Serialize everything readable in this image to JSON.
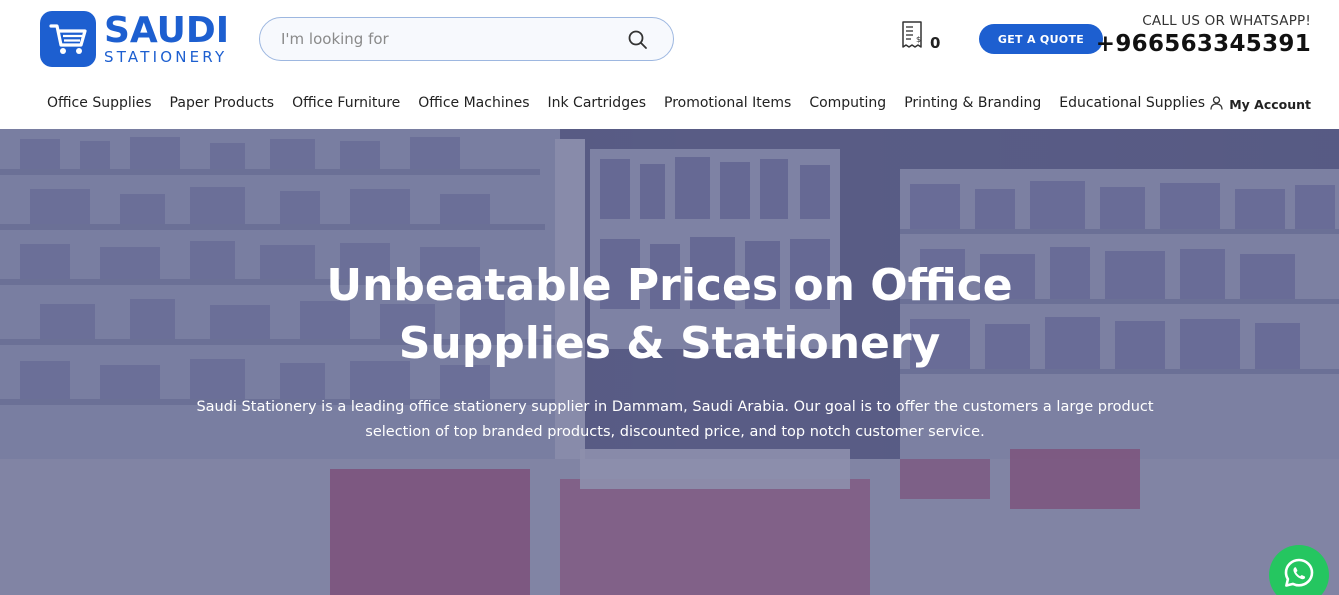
{
  "header": {
    "logo": {
      "main": "SAUDI",
      "sub": "STATIONERY"
    },
    "search": {
      "placeholder": "I'm looking for"
    },
    "quote_count": "0",
    "quote_button": "GET A QUOTE",
    "call_label": "CALL US OR WHATSAPP!",
    "phone": "+966563345391"
  },
  "nav": {
    "items": [
      {
        "label": "Office Supplies"
      },
      {
        "label": "Paper Products"
      },
      {
        "label": "Office Furniture"
      },
      {
        "label": "Office Machines"
      },
      {
        "label": "Ink Cartridges"
      },
      {
        "label": "Promotional Items"
      },
      {
        "label": "Computing"
      },
      {
        "label": "Printing & Branding"
      },
      {
        "label": "Educational Supplies"
      }
    ],
    "account": "My Account"
  },
  "hero": {
    "title_line1": "Unbeatable Prices on Office",
    "title_line2": "Supplies & Stationery",
    "description_line1": "Saudi Stationery is a leading office stationery supplier in Dammam, Saudi Arabia. Our goal is to offer the customers a large product",
    "description_line2": "selection of top branded products, discounted price, and top notch customer service."
  },
  "colors": {
    "brand": "#1d5fd0",
    "whatsapp": "#25c660",
    "hero_tint": "#525480"
  },
  "icons": [
    "cart-logo-icon",
    "search-icon",
    "quote-list-icon",
    "user-icon",
    "whatsapp-icon"
  ]
}
